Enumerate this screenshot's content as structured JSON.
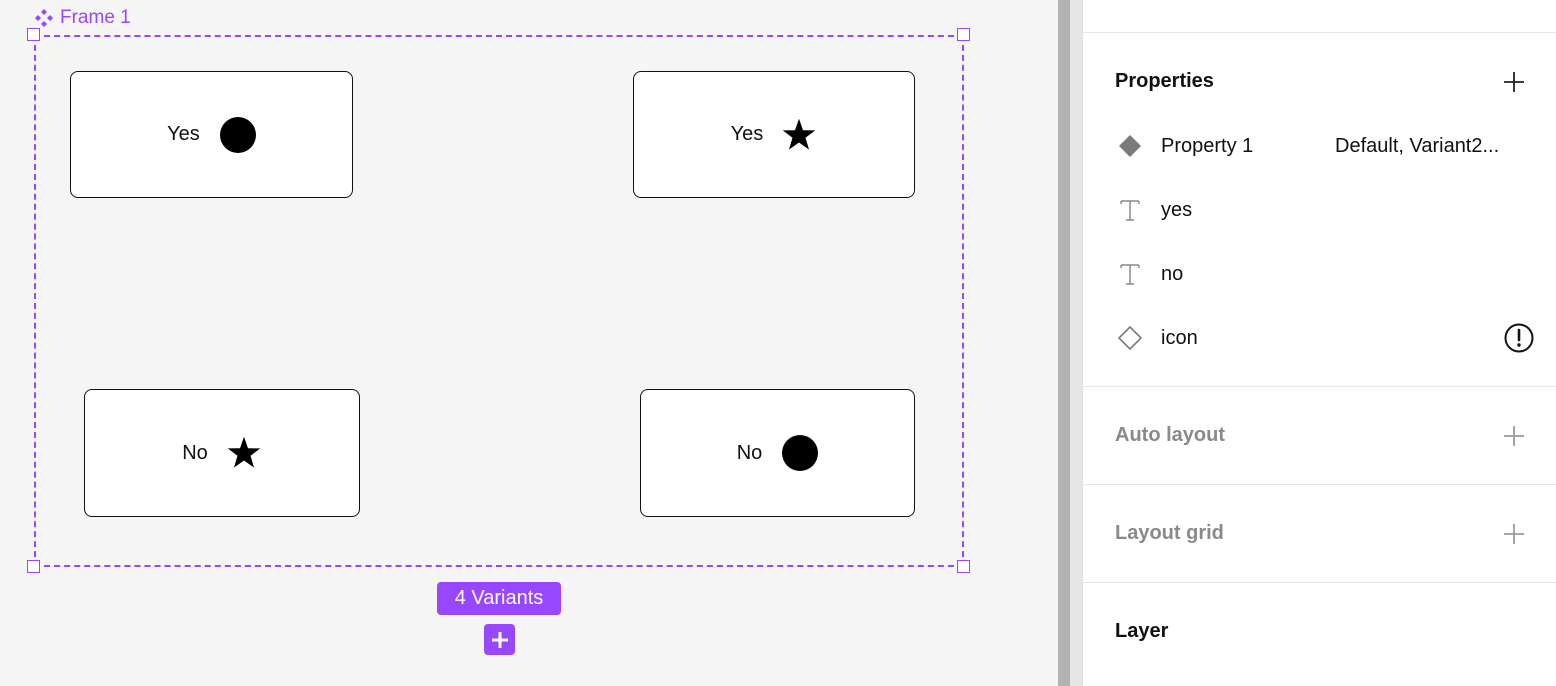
{
  "canvas": {
    "frame_name": "Frame 1",
    "variants": [
      {
        "label": "Yes",
        "icon": "circle-icon"
      },
      {
        "label": "Yes",
        "icon": "star-icon"
      },
      {
        "label": "No",
        "icon": "star-icon"
      },
      {
        "label": "No",
        "icon": "circle-icon"
      }
    ],
    "variants_badge": "4 Variants",
    "accent_color": "#9747ff"
  },
  "panel": {
    "properties": {
      "title": "Properties",
      "items": [
        {
          "name": "Property 1",
          "value": "Default, Variant2...",
          "icon": "variant-property-icon"
        },
        {
          "name": "yes",
          "icon": "text-property-icon"
        },
        {
          "name": "no",
          "icon": "text-property-icon"
        },
        {
          "name": "icon",
          "icon": "instance-swap-icon",
          "status": "warning-icon"
        }
      ]
    },
    "auto_layout": {
      "title": "Auto layout"
    },
    "layout_grid": {
      "title": "Layout grid"
    },
    "layer": {
      "title": "Layer"
    }
  }
}
